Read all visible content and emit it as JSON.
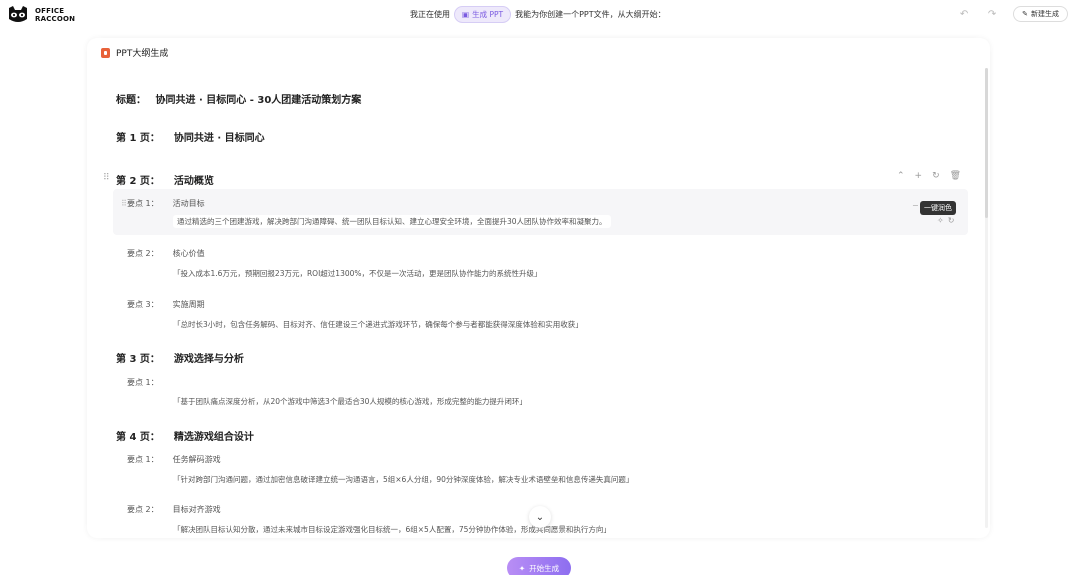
{
  "app": {
    "logo_line1": "OFFICE",
    "logo_line2": "RACCOON"
  },
  "topbar": {
    "prefix": "我正在使用",
    "pill_label": "生成 PPT",
    "suffix": "我能为你创建一个PPT文件，从大纲开始：",
    "back_icon": "undo-arrow-icon",
    "forward_icon": "redo-arrow-icon",
    "new_label": "新建生成"
  },
  "card": {
    "header": "PPT大纲生成",
    "title_label": "标题：",
    "title_value": "协同共进 · 目标同心 - 30人团建活动策划方案"
  },
  "pages": [
    {
      "label": "第 1 页：",
      "title": "协同共进 · 目标同心"
    },
    {
      "label": "第 2 页：",
      "title": "活动概览"
    },
    {
      "label": "第 3 页：",
      "title": "游戏选择与分析"
    },
    {
      "label": "第 4 页：",
      "title": "精选游戏组合设计"
    }
  ],
  "points": [
    {
      "label": "要点 1：",
      "title": "活动目标",
      "desc": "通过精选的三个团建游戏，解决跨部门沟通障碍、统一团队目标认知、建立心理安全环境，全面提升30人团队协作效率和凝聚力。"
    },
    {
      "label": "要点 2：",
      "title": "核心价值",
      "desc": "「投入成本1.6万元，预期回报23万元，ROI超过1300%，不仅是一次活动，更是团队协作能力的系统性升级」"
    },
    {
      "label": "要点 3：",
      "title": "实施周期",
      "desc": "「总时长3小时，包含任务解码、目标对齐、信任建设三个递进式游戏环节，确保每个参与者都能获得深度体验和实用收获」"
    },
    {
      "label": "要点 1：",
      "title": "",
      "desc": "「基于团队痛点深度分析，从20个游戏中筛选3个最适合30人规模的核心游戏，形成完整的能力提升闭环」"
    },
    {
      "label": "要点 1：",
      "title": "任务解码游戏",
      "desc": "「针对跨部门沟通问题，通过加密信息破译建立统一沟通语言，5组×6人分组，90分钟深度体验，解决专业术语壁垒和信息传递失真问题」"
    },
    {
      "label": "要点 2：",
      "title": "目标对齐游戏",
      "desc": "「解决团队目标认知分散，通过未来城市目标设定游戏强化目标统一，6组×5人配置，75分钟协作体验，形成共同愿景和执行方向」"
    }
  ],
  "tooltip": "一键润色",
  "actions": {
    "up": "chevron-up-icon",
    "add": "plus-icon",
    "refresh": "refresh-icon",
    "delete": "trash-icon"
  },
  "start_button": "开始生成"
}
